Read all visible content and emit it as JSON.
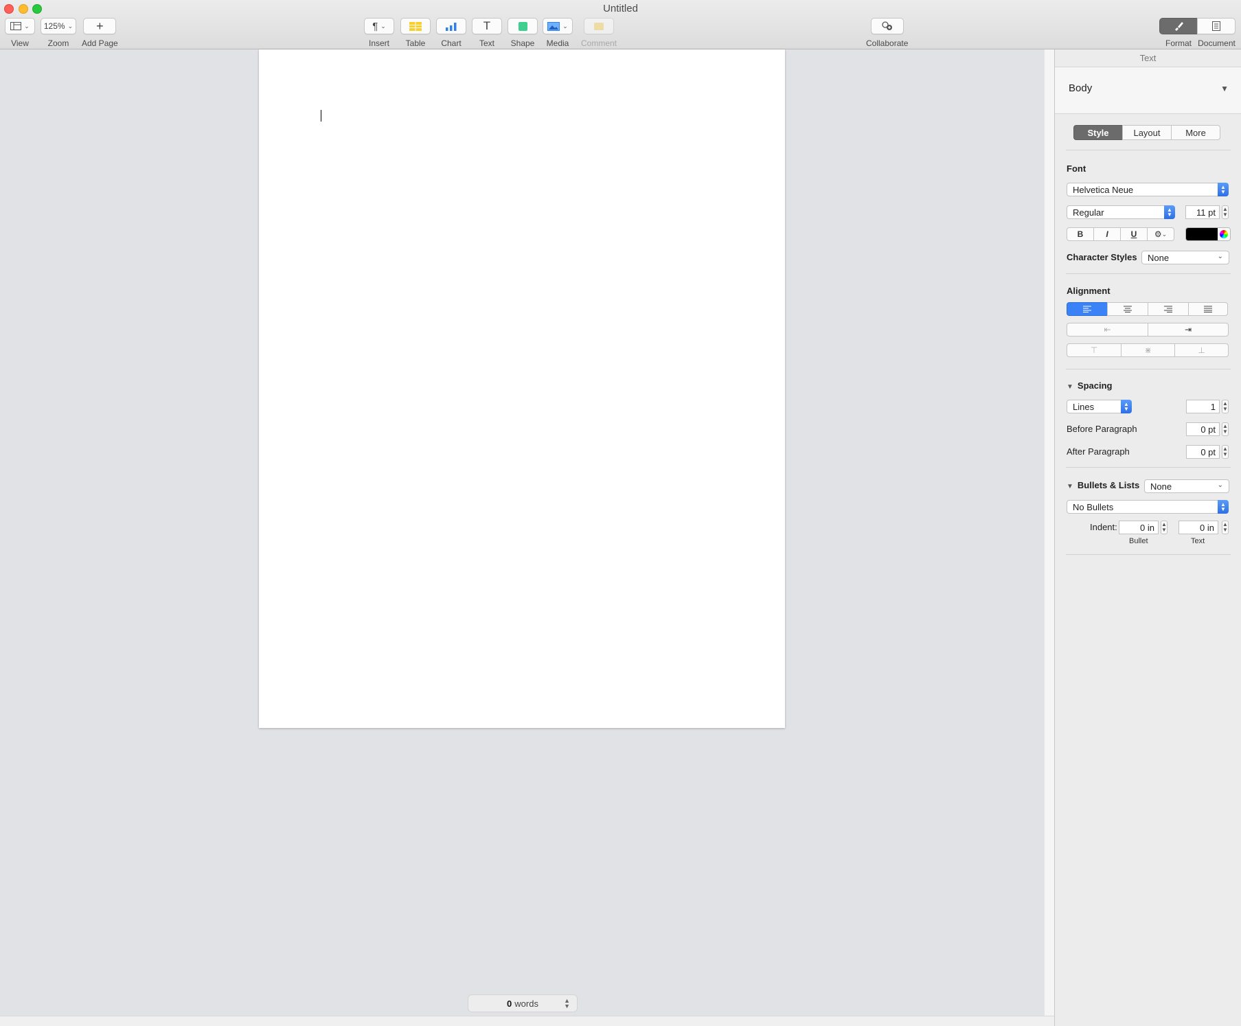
{
  "window": {
    "title": "Untitled"
  },
  "toolbar": {
    "view_label": "View",
    "zoom_value": "125%",
    "zoom_label": "Zoom",
    "add_page_label": "Add Page",
    "insert_label": "Insert",
    "table_label": "Table",
    "chart_label": "Chart",
    "text_label": "Text",
    "shape_label": "Shape",
    "media_label": "Media",
    "comment_label": "Comment",
    "collaborate_label": "Collaborate",
    "format_label": "Format",
    "document_label": "Document"
  },
  "status": {
    "word_count": "0",
    "word_unit": "words"
  },
  "inspector": {
    "header": "Text",
    "paragraph_style": "Body",
    "tabs": [
      "Style",
      "Layout",
      "More"
    ],
    "active_tab": "Style",
    "font_heading": "Font",
    "font_family": "Helvetica Neue",
    "font_typeface": "Regular",
    "font_size": "11 pt",
    "bold_glyph": "B",
    "italic_glyph": "I",
    "underline_glyph": "U",
    "text_color": "#000000",
    "character_styles_label": "Character Styles",
    "character_styles_value": "None",
    "alignment_heading": "Alignment",
    "alignment_selected": "left",
    "spacing_heading": "Spacing",
    "spacing_mode": "Lines",
    "spacing_value": "1",
    "before_paragraph_label": "Before Paragraph",
    "before_paragraph_value": "0 pt",
    "after_paragraph_label": "After Paragraph",
    "after_paragraph_value": "0 pt",
    "bullets_heading": "Bullets & Lists",
    "bullets_style": "None",
    "bullets_type": "No Bullets",
    "indent_label": "Indent:",
    "bullet_indent_value": "0 in",
    "text_indent_value": "0 in",
    "bullet_caption": "Bullet",
    "text_caption": "Text"
  },
  "colors": {
    "accent": "#3a82f6",
    "active_segment": "#6b6b6b",
    "canvas": "#e1e2e6"
  }
}
